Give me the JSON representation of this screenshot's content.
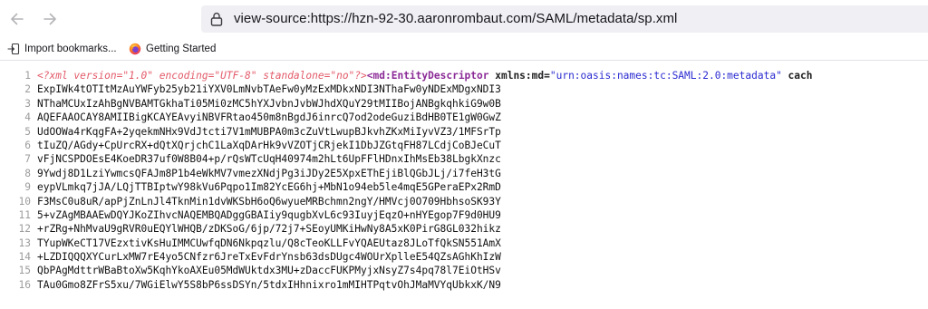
{
  "nav": {
    "back_icon": "arrow-left-icon",
    "forward_icon": "arrow-right-icon",
    "lock_icon": "lock-icon"
  },
  "url": {
    "text": "view-source:https://hzn-92-30.aaronrombaut.com/SAML/metadata/sp.xml"
  },
  "bookmarks": [
    {
      "label": "Import bookmarks...",
      "icon": "import-icon"
    },
    {
      "label": "Getting Started",
      "icon": "firefox-icon"
    }
  ],
  "source": {
    "line1": {
      "num": "1",
      "pi_open": "<?xml",
      "pi_v_attr": " version=",
      "pi_v_val": "\"1.0\"",
      "pi_e_attr": " encoding=",
      "pi_e_val": "\"UTF-8\"",
      "pi_s_attr": " standalone=",
      "pi_s_val": "\"no\"",
      "pi_close": "?>",
      "tag": "<md:EntityDescriptor",
      "attr": " xmlns:md=",
      "attr_val": "\"urn:oasis:names:tc:SAML:2.0:metadata\"",
      "tail": " cach"
    },
    "lines": [
      {
        "num": "2",
        "text": "ExpIWk4tOTItMzAuYWFyb25yb21iYXV0LmNvbTAeFw0yMzExMDkxNDI3NThaFw0yNDExMDgxNDI3"
      },
      {
        "num": "3",
        "text": "NThaMCUxIzAhBgNVBAMTGkhaTi05Mi0zMC5hYXJvbnJvbWJhdXQuY29tMIIBojANBgkqhkiG9w0B"
      },
      {
        "num": "4",
        "text": "AQEFAAOCAY8AMIIBigKCAYEAvyiNBVFRtao450m8nBgdJ6inrcQ7od2odeGuziBdHB0TE1gW0GwZ"
      },
      {
        "num": "5",
        "text": "UdOOWa4rKqgFA+2yqekmNHx9VdJtcti7V1mMUBPA0m3cZuVtLwupBJkvhZKxMiIyvVZ3/1MFSrTp"
      },
      {
        "num": "6",
        "text": "tIuZQ/AGdy+CpUrcRX+dQtXQrjchC1LaXqDArHk9vVZOTjCRjekI1DbJZGtqFH87LCdjCoBJeCuT"
      },
      {
        "num": "7",
        "text": "vFjNCSPDOEsE4KoeDR37uf0W8B04+p/rQsWTcUqH40974m2hLt6UpFFlHDnxIhMsEb38LbgkXnzc"
      },
      {
        "num": "8",
        "text": "9Ywdj8D1LziYwmcsQFAJm8P1b4eWkMV7vmezXNdjPg3iJDy2E5XpxEThEjiBlQGbJLj/i7feH3tG"
      },
      {
        "num": "9",
        "text": "eypVLmkq7jJA/LQjTTBIptwY98kVu6Pqpo1Im82YcEG6hj+MbN1o94eb5le4mqE5GPeraEPx2RmD"
      },
      {
        "num": "10",
        "text": "F3MsC0u8uR/apPjZnLnJl4TknMin1dvWKSbH6oQ6wyueMRBchmn2ngY/HMVcj0O709HbhsoSK93Y"
      },
      {
        "num": "11",
        "text": "5+vZAgMBAAEwDQYJKoZIhvcNAQEMBQADggGBAIiy9qugbXvL6c93IuyjEqzO+nHYEgop7F9d0HU9"
      },
      {
        "num": "12",
        "text": "+rZRg+NhMvaU9gRVR0uEQYlWHQB/zDKSoG/6jp/72j7+SEoyUMKiHwNy8A5xK0PirG8GL032hikz"
      },
      {
        "num": "13",
        "text": "TYupWKeCT17VEzxtivKsHuIMMCUwfqDN6Nkpqzlu/Q8cTeoKLLFvYQAEUtaz8JLoTfQkSN551AmX"
      },
      {
        "num": "14",
        "text": "+LZDIQQQXYCurLxMW7rE4yo5CNfzr6JreTxEvFdrYnsb63dsDUgc4WOUrXplleE54QZsAGhKhIzW"
      },
      {
        "num": "15",
        "text": "QbPAgMdttrWBaBtoXw5KqhYkoAXEu05MdWUktdx3MU+zDaccFUKPMyjxNsyZ7s4pq78l7EiOtHSv"
      },
      {
        "num": "16",
        "text": "TAu0Gmo8ZFrS5xu/7WGiElwY5S8bP6ssDSYn/5tdxIHhnixro1mMIHTPqtvOhJMaMVYqUbkxK/N9"
      }
    ]
  }
}
